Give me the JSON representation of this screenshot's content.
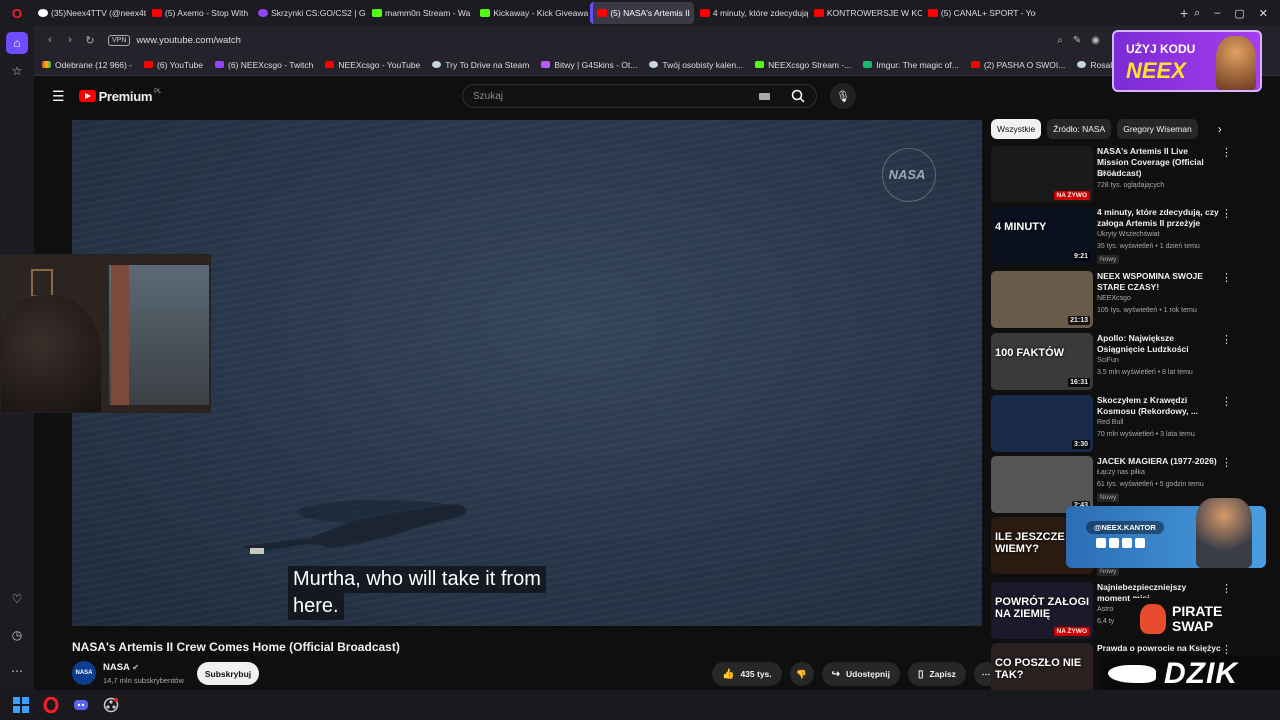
{
  "browser": {
    "tabs": [
      {
        "label": "(35)Neex4TTV (@neex4ttv",
        "fav": "tt"
      },
      {
        "label": "(5) Axemo - Stop With",
        "fav": "yt"
      },
      {
        "label": "Skrzynki CS:GO/CS2 | G4S",
        "fav": "purple"
      },
      {
        "label": "mamm0n Stream - Wa",
        "fav": "kick"
      },
      {
        "label": "Kickaway - Kick Giveaway",
        "fav": "kick"
      },
      {
        "label": "(5) NASA's Artemis II",
        "fav": "yt",
        "active": true
      },
      {
        "label": "4 minuty, które zdecydują",
        "fav": "yt"
      },
      {
        "label": "KONTROWERSJE W KOŃC",
        "fav": "yt"
      },
      {
        "label": "(5) CANAL+ SPORT - You",
        "fav": "yt"
      }
    ],
    "vpn_label": "VPN",
    "url": "www.youtube.com/watch",
    "bookmarks": [
      {
        "label": "Odebrane (12 966) -",
        "fav": "gm"
      },
      {
        "label": "(6) YouTube",
        "fav": "yt"
      },
      {
        "label": "(6) NEEXcsgo - Twitch",
        "fav": "tw"
      },
      {
        "label": "NEEXcsgo - YouTube",
        "fav": "yt"
      },
      {
        "label": "Try To Drive na Steam",
        "fav": "steam"
      },
      {
        "label": "Bitwy | G4Skins - Ot...",
        "fav": "g4"
      },
      {
        "label": "Twój osobisty kalen...",
        "fav": "steam"
      },
      {
        "label": "NEEXcsgo Stream -...",
        "fav": "kick"
      },
      {
        "label": "Imgur: The magic of...",
        "fav": "imgur"
      },
      {
        "label": "(2) PASHA O SWOI...",
        "fav": "yt"
      },
      {
        "label": "Rosalie na Steam",
        "fav": "steam"
      }
    ]
  },
  "youtube": {
    "logo_word": "Premium",
    "logo_region": "PL",
    "search_placeholder": "Szukaj",
    "video": {
      "watermark": "NASA",
      "subtitle_line1": "Murtha, who will take it from",
      "subtitle_line2": "here.",
      "title": "NASA's Artemis II Crew Comes Home (Official Broadcast)",
      "channel": "NASA",
      "subscribers": "14,7 mln subskrybentów",
      "subscribe_label": "Subskrybuj",
      "likes": "435 tys.",
      "share_label": "Udostępnij",
      "save_label": "Zapisz"
    },
    "chips": [
      "Wszystkie",
      "Źródło: NASA",
      "Gregory Wiseman"
    ],
    "recommendations": [
      {
        "title": "NASA's Artemis II Live Mission Coverage (Official Broadcast)",
        "channel": "NASA",
        "meta": "728 tys. oglądających",
        "badge": "NA ŻYWO",
        "badge_type": "live",
        "thumb_text": "",
        "thumb_bg": "#1a1a1a",
        "new": ""
      },
      {
        "title": "4 minuty, które zdecydują, czy załoga Artemis II przeżyje",
        "channel": "Ukryty Wszechświat",
        "meta": "35 tys. wyświetleń • 1 dzień temu",
        "badge": "9:21",
        "badge_type": "dur",
        "thumb_text": "4 MINUTY",
        "thumb_bg": "#0a1020",
        "new": "Nowy"
      },
      {
        "title": "NEEX WSPOMINA SWOJE STARE CZASY!",
        "channel": "NEEXcsgo",
        "meta": "105 tys. wyświetleń • 1 rok temu",
        "badge": "21:13",
        "badge_type": "dur",
        "thumb_text": "",
        "thumb_bg": "#6a5a4a",
        "new": ""
      },
      {
        "title": "Apollo: Największe Osiągnięcie Ludzkości",
        "channel": "SciFun",
        "meta": "3,5 mln wyświetleń • 8 lat temu",
        "badge": "16:31",
        "badge_type": "dur",
        "thumb_text": "100 FAKTÓW",
        "thumb_bg": "#3a3a3a",
        "new": ""
      },
      {
        "title": "Skoczyłem z Krawędzi Kosmosu (Rekordowy, ...",
        "channel": "Red Bull",
        "meta": "70 mln wyświetleń • 3 lata temu",
        "badge": "3:30",
        "badge_type": "dur",
        "thumb_text": "",
        "thumb_bg": "#1a2a4a",
        "new": ""
      },
      {
        "title": "JACEK MAGIERA (1977-2026)",
        "channel": "Łączy nas piłka",
        "meta": "61 tys. wyświetleń • 5 godzin temu",
        "badge": "2:43",
        "badge_type": "dur",
        "thumb_text": "",
        "thumb_bg": "#555555",
        "new": "Nowy"
      },
      {
        "title": "",
        "channel": "",
        "meta": "",
        "badge": "",
        "badge_type": "none",
        "thumb_text": "ILE JESZCZE NIE WIEMY?",
        "thumb_bg": "#2a1a10",
        "new": "Nowy"
      },
      {
        "title": "Najniebezpieczniejszy moment misj",
        "channel": "Astro",
        "meta": "6,4 ty",
        "badge": "NA ŻYWO",
        "badge_type": "live",
        "thumb_text": "POWRÓT ZAŁOGI NA ZIEMIĘ",
        "thumb_bg": "#1a1a2a",
        "new": ""
      },
      {
        "title": "Prawda o powrocie na Księżyc",
        "channel": "",
        "meta": "",
        "badge": "",
        "badge_type": "none",
        "thumb_text": "CO POSZŁO NIE TAK?",
        "thumb_bg": "#2a2020",
        "new": ""
      }
    ]
  },
  "overlays": {
    "promo_line1": "UŻYJ KODU",
    "promo_line2": "NEEX",
    "kantor_handle": "@NEEX.KANTOR",
    "pirate_line1": "PIRATE",
    "pirate_line2": "SWAP",
    "dzik": "DZIK"
  }
}
